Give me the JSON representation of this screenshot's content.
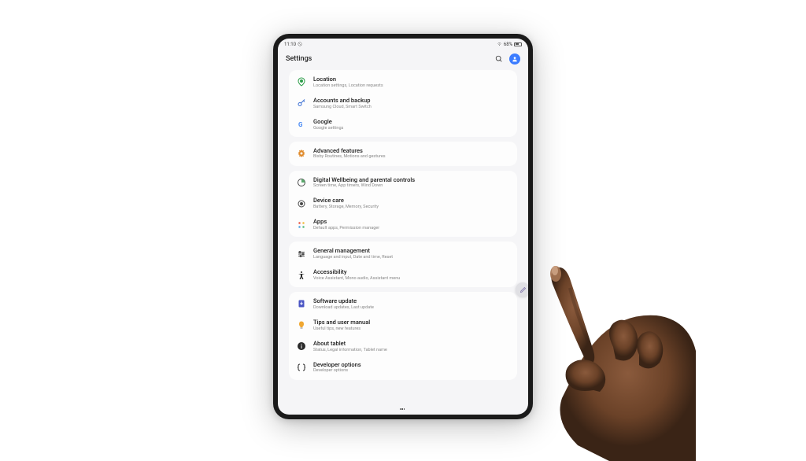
{
  "status": {
    "time": "11:10",
    "battery_text": "68%"
  },
  "header": {
    "title": "Settings"
  },
  "groups": [
    {
      "items": [
        {
          "icon": "location",
          "title": "Location",
          "sub": "Location settings, Location requests"
        },
        {
          "icon": "key",
          "title": "Accounts and backup",
          "sub": "Samsung Cloud, Smart Switch"
        },
        {
          "icon": "google",
          "title": "Google",
          "sub": "Google settings"
        }
      ]
    },
    {
      "items": [
        {
          "icon": "gear-orange",
          "title": "Advanced features",
          "sub": "Bixby Routines, Motions and gestures"
        }
      ]
    },
    {
      "items": [
        {
          "icon": "wellbeing",
          "title": "Digital Wellbeing and parental controls",
          "sub": "Screen time, App timers, Wind Down"
        },
        {
          "icon": "device-care",
          "title": "Device care",
          "sub": "Battery, Storage, Memory, Security"
        },
        {
          "icon": "apps",
          "title": "Apps",
          "sub": "Default apps, Permission manager"
        }
      ]
    },
    {
      "items": [
        {
          "icon": "general",
          "title": "General management",
          "sub": "Language and input, Date and time, Reset"
        },
        {
          "icon": "accessibility",
          "title": "Accessibility",
          "sub": "Voice Assistant, Mono audio, Assistant menu"
        }
      ]
    },
    {
      "items": [
        {
          "icon": "software",
          "title": "Software update",
          "sub": "Download updates, Last update"
        },
        {
          "icon": "tips",
          "title": "Tips and user manual",
          "sub": "Useful tips, new features"
        },
        {
          "icon": "about",
          "title": "About tablet",
          "sub": "Status, Legal information, Tablet name"
        },
        {
          "icon": "developer",
          "title": "Developer options",
          "sub": "Developer options"
        }
      ]
    }
  ]
}
